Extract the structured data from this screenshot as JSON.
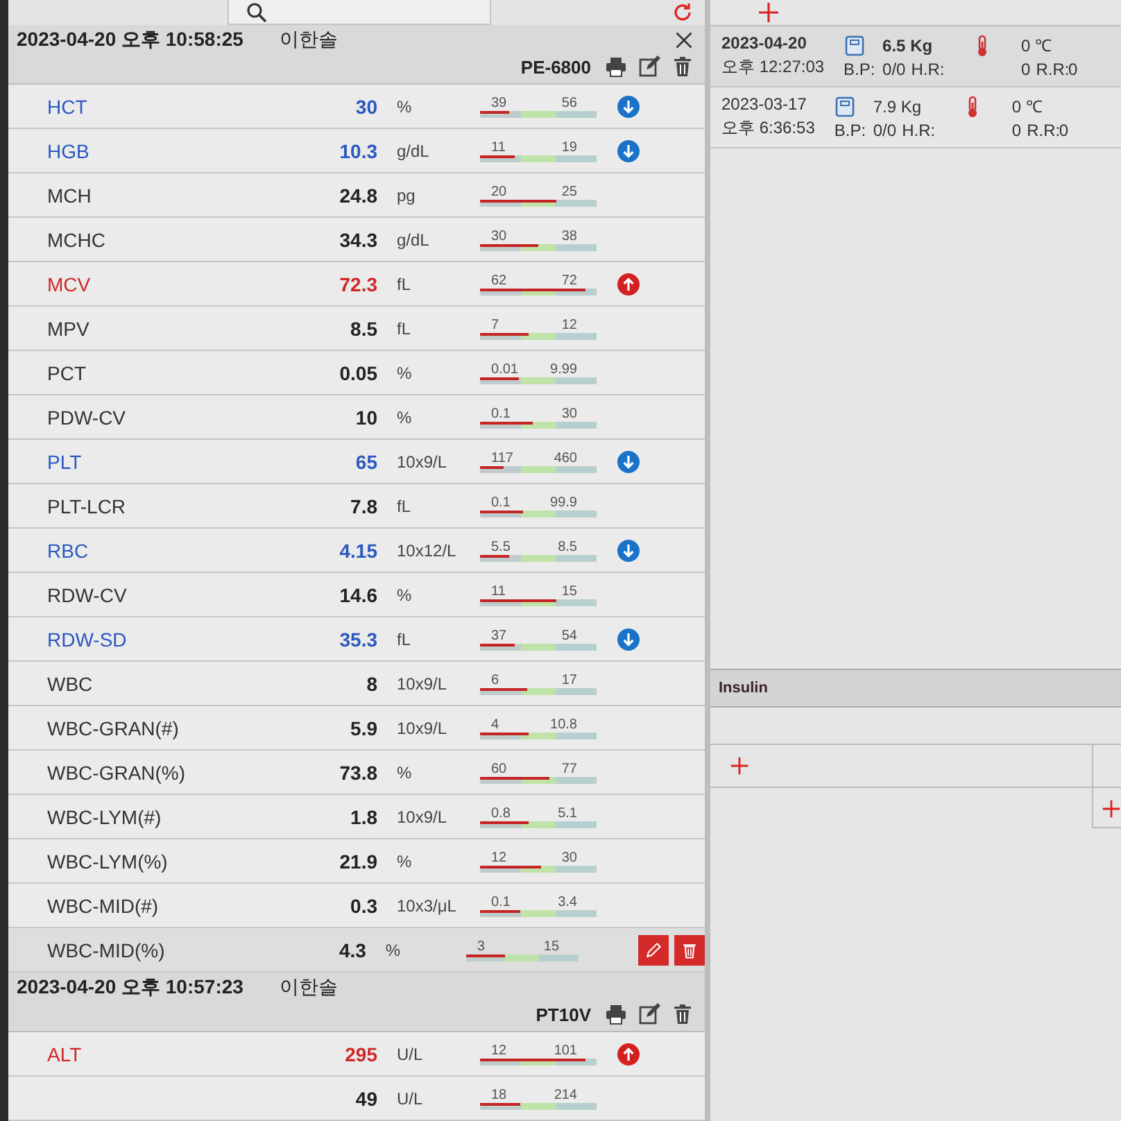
{
  "records": [
    {
      "datetime": "2023-04-20 오후 10:58:25",
      "patient": "이한솔",
      "device": "PE-6800",
      "closable": true,
      "rows": [
        {
          "name": "HCT",
          "value": "30",
          "unit": "%",
          "low": "39",
          "high": "56",
          "level": 0.25,
          "below": true,
          "above": false,
          "hovered": false
        },
        {
          "name": "HGB",
          "value": "10.3",
          "unit": "g/dL",
          "low": "11",
          "high": "19",
          "level": 0.3,
          "below": true,
          "above": false,
          "hovered": false
        },
        {
          "name": "MCH",
          "value": "24.8",
          "unit": "pg",
          "low": "20",
          "high": "25",
          "level": 0.65,
          "below": false,
          "above": false,
          "hovered": false
        },
        {
          "name": "MCHC",
          "value": "34.3",
          "unit": "g/dL",
          "low": "30",
          "high": "38",
          "level": 0.5,
          "below": false,
          "above": false,
          "hovered": false
        },
        {
          "name": "MCV",
          "value": "72.3",
          "unit": "fL",
          "low": "62",
          "high": "72",
          "level": 0.9,
          "below": false,
          "above": true,
          "hovered": false
        },
        {
          "name": "MPV",
          "value": "8.5",
          "unit": "fL",
          "low": "7",
          "high": "12",
          "level": 0.42,
          "below": false,
          "above": false,
          "hovered": false
        },
        {
          "name": "PCT",
          "value": "0.05",
          "unit": "%",
          "low": "0.01",
          "high": "9.99",
          "level": 0.33,
          "below": false,
          "above": false,
          "hovered": false
        },
        {
          "name": "PDW-CV",
          "value": "10",
          "unit": "%",
          "low": "0.1",
          "high": "30",
          "level": 0.45,
          "below": false,
          "above": false,
          "hovered": false
        },
        {
          "name": "PLT",
          "value": "65",
          "unit": "10x9/L",
          "low": "117",
          "high": "460",
          "level": 0.2,
          "below": true,
          "above": false,
          "hovered": false
        },
        {
          "name": "PLT-LCR",
          "value": "7.8",
          "unit": "fL",
          "low": "0.1",
          "high": "99.9",
          "level": 0.37,
          "below": false,
          "above": false,
          "hovered": false
        },
        {
          "name": "RBC",
          "value": "4.15",
          "unit": "10x12/L",
          "low": "5.5",
          "high": "8.5",
          "level": 0.25,
          "below": true,
          "above": false,
          "hovered": false
        },
        {
          "name": "RDW-CV",
          "value": "14.6",
          "unit": "%",
          "low": "11",
          "high": "15",
          "level": 0.65,
          "below": false,
          "above": false,
          "hovered": false
        },
        {
          "name": "RDW-SD",
          "value": "35.3",
          "unit": "fL",
          "low": "37",
          "high": "54",
          "level": 0.3,
          "below": true,
          "above": false,
          "hovered": false
        },
        {
          "name": "WBC",
          "value": "8",
          "unit": "10x9/L",
          "low": "6",
          "high": "17",
          "level": 0.4,
          "below": false,
          "above": false,
          "hovered": false
        },
        {
          "name": "WBC-GRAN(#)",
          "value": "5.9",
          "unit": "10x9/L",
          "low": "4",
          "high": "10.8",
          "level": 0.42,
          "below": false,
          "above": false,
          "hovered": false
        },
        {
          "name": "WBC-GRAN(%)",
          "value": "73.8",
          "unit": "%",
          "low": "60",
          "high": "77",
          "level": 0.6,
          "below": false,
          "above": false,
          "hovered": false
        },
        {
          "name": "WBC-LYM(#)",
          "value": "1.8",
          "unit": "10x9/L",
          "low": "0.8",
          "high": "5.1",
          "level": 0.42,
          "below": false,
          "above": false,
          "hovered": false
        },
        {
          "name": "WBC-LYM(%)",
          "value": "21.9",
          "unit": "%",
          "low": "12",
          "high": "30",
          "level": 0.52,
          "below": false,
          "above": false,
          "hovered": false
        },
        {
          "name": "WBC-MID(#)",
          "value": "0.3",
          "unit": "10x3/μL",
          "low": "0.1",
          "high": "3.4",
          "level": 0.35,
          "below": false,
          "above": false,
          "hovered": false
        },
        {
          "name": "WBC-MID(%)",
          "value": "4.3",
          "unit": "%",
          "low": "3",
          "high": "15",
          "level": 0.35,
          "below": false,
          "above": false,
          "hovered": true
        }
      ]
    },
    {
      "datetime": "2023-04-20 오후 10:57:23",
      "patient": "이한솔",
      "device": "PT10V",
      "closable": false,
      "rows": [
        {
          "name": "ALT",
          "value": "295",
          "unit": "U/L",
          "low": "12",
          "high": "101",
          "level": 0.9,
          "below": false,
          "above": true,
          "hovered": false
        },
        {
          "value": "49",
          "unit": "U/L",
          "low": "18",
          "high": "214",
          "level": 0.35,
          "below": false,
          "above": false,
          "hovered": false
        }
      ]
    }
  ],
  "vitals": [
    {
      "date": "2023-04-20",
      "time": "오후 12:27:03",
      "weight": "6.5 Kg",
      "temperature": "0 ℃",
      "bp_label": "B.P:",
      "bp": "0/0",
      "hr_label": "H.R:",
      "hr": "0",
      "rr_label": "R.R:",
      "rr": "0",
      "selected": true
    },
    {
      "date": "2023-03-17",
      "time": "오후 6:36:53",
      "weight": "7.9 Kg",
      "temperature": "0 ℃",
      "bp_label": "B.P:",
      "bp": "0/0",
      "hr_label": "H.R:",
      "hr": "0",
      "rr_label": "R.R:",
      "rr": "0",
      "selected": false
    }
  ],
  "insulin": {
    "title": "Insulin"
  }
}
